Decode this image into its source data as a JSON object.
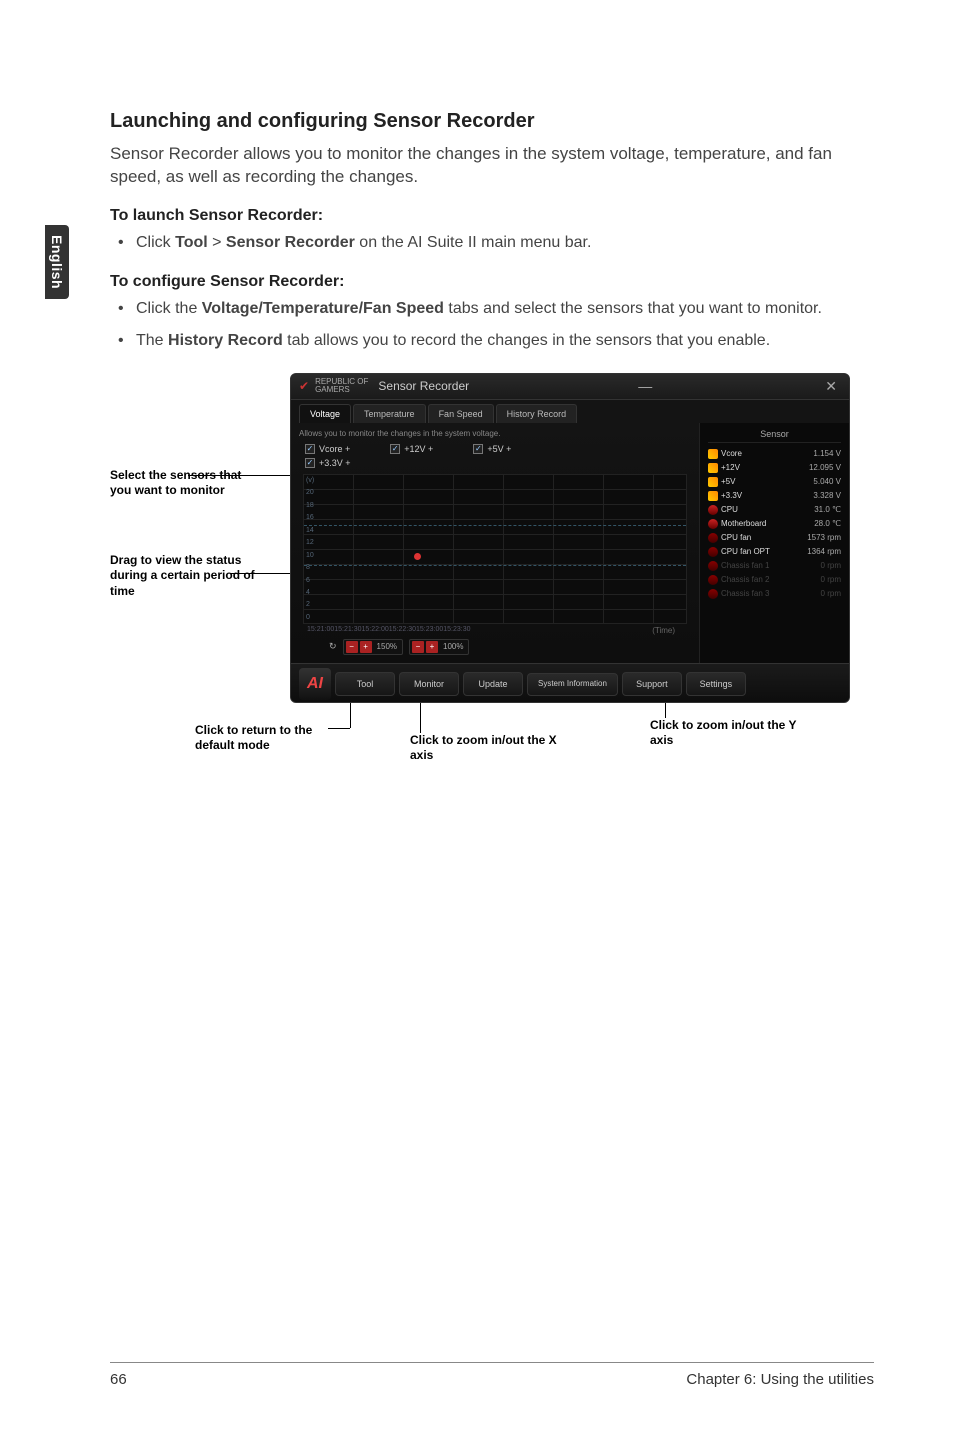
{
  "side_tab": "English",
  "title": "Launching and configuring Sensor Recorder",
  "intro": "Sensor Recorder allows you to monitor the changes in the system voltage, temperature, and fan speed, as well as recording the changes.",
  "launch_heading": "To launch Sensor Recorder:",
  "launch_bullet_pre": "Click ",
  "launch_tool": "Tool",
  "launch_gt": " > ",
  "launch_sensor": "Sensor Recorder",
  "launch_bullet_post": " on the AI Suite II main menu bar.",
  "config_heading": "To configure Sensor Recorder:",
  "config_b1_pre": "Click the ",
  "config_b1_bold": "Voltage/Temperature/Fan Speed",
  "config_b1_post": " tabs and select the sensors that you want to monitor.",
  "config_b2_pre": "The ",
  "config_b2_bold": "History Record",
  "config_b2_post": " tab allows you to record the changes in the sensors that you enable.",
  "callouts": {
    "select": "Select the sensors that you want to monitor",
    "drag": "Drag to view the status during a certain period of time",
    "return": "Click to return to the default mode",
    "zoomx": "Click to zoom in/out the X axis",
    "zoomy": "Click to zoom in/out the Y axis"
  },
  "screenshot": {
    "titlebrand1": "REPUBLIC OF",
    "titlebrand2": "GAMERS",
    "title": "Sensor Recorder",
    "tabs": [
      "Voltage",
      "Temperature",
      "Fan Speed",
      "History Record"
    ],
    "help": "Allows you to monitor the changes in the system voltage.",
    "checks": [
      "Vcore +",
      "+12V +",
      "+5V +",
      "+3.3V +"
    ],
    "yticks": [
      "(v)",
      "20",
      "18",
      "16",
      "14",
      "12",
      "10",
      "8",
      "6",
      "4",
      "2",
      "0"
    ],
    "xticks": [
      "15:21:00",
      "15:21:30",
      "15:22:00",
      "15:22:30",
      "15:23:00",
      "15:23:30"
    ],
    "zoom1": "150%",
    "zoom2": "100%",
    "timelabel": "(Time)",
    "side_header": "Sensor",
    "sensors": [
      {
        "cls": "volt",
        "label": "Vcore",
        "val": "1.154 V"
      },
      {
        "cls": "volt",
        "label": "+12V",
        "val": "12.095 V"
      },
      {
        "cls": "volt",
        "label": "+5V",
        "val": "5.040 V"
      },
      {
        "cls": "volt",
        "label": "+3.3V",
        "val": "3.328 V"
      },
      {
        "cls": "temp",
        "label": "CPU",
        "val": "31.0 ℃"
      },
      {
        "cls": "temp",
        "label": "Motherboard",
        "val": "28.0 ℃"
      },
      {
        "cls": "fan",
        "label": "CPU fan",
        "val": "1573 rpm"
      },
      {
        "cls": "fan",
        "label": "CPU fan OPT",
        "val": "1364 rpm"
      },
      {
        "cls": "fan dim",
        "label": "Chassis fan 1",
        "val": "0 rpm"
      },
      {
        "cls": "fan dim",
        "label": "Chassis fan 2",
        "val": "0 rpm"
      },
      {
        "cls": "fan dim",
        "label": "Chassis fan 3",
        "val": "0 rpm"
      }
    ],
    "bottom": {
      "logo": "AI",
      "b0": "Tool",
      "b1": "Monitor",
      "b2": "Update",
      "b3": "System Information",
      "b4": "Support",
      "b5": "Settings"
    }
  },
  "footer": {
    "page": "66",
    "chapter": "Chapter 6: Using the utilities"
  }
}
